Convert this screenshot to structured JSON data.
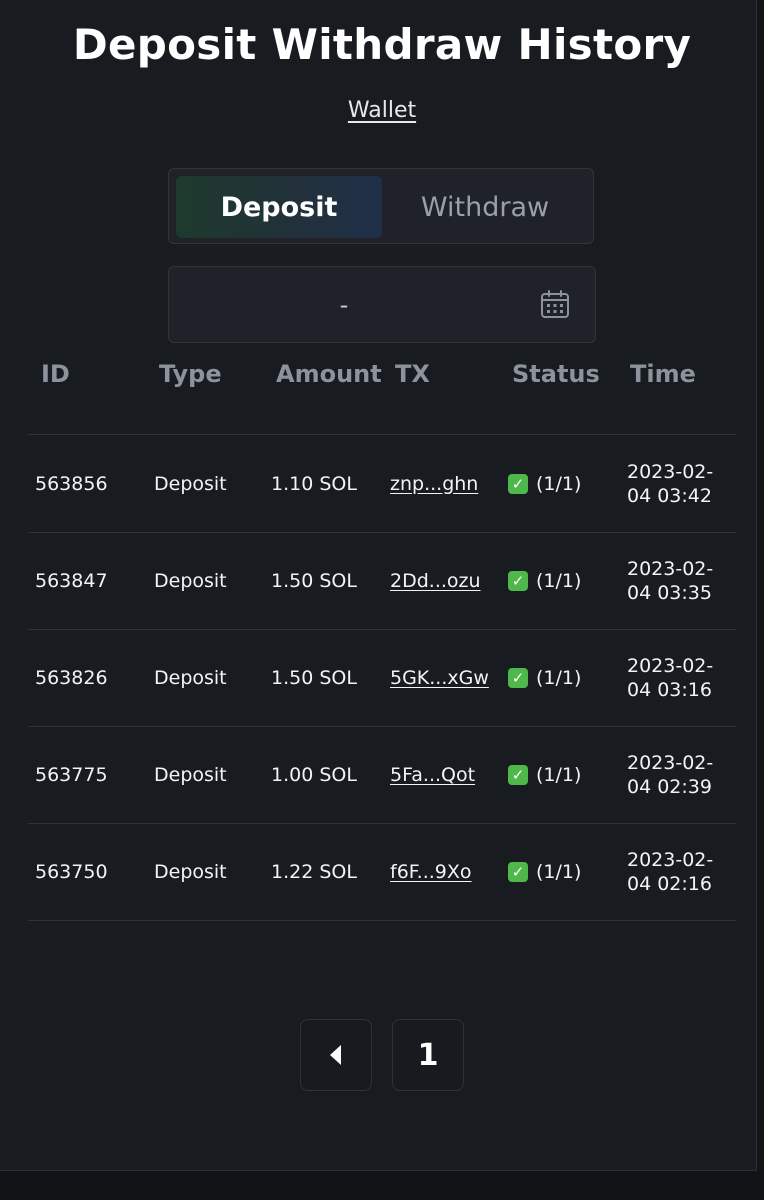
{
  "header": {
    "title": "Deposit Withdraw History",
    "wallet_link": "Wallet"
  },
  "tabs": [
    {
      "label": "Deposit",
      "active": true
    },
    {
      "label": "Withdraw",
      "active": false
    }
  ],
  "date_filter": {
    "value": "-",
    "icon": "calendar-icon"
  },
  "table": {
    "columns": [
      "ID",
      "Type",
      "Amount",
      "TX",
      "Status",
      "Time"
    ],
    "rows": [
      {
        "id": "563856",
        "type": "Deposit",
        "amount": "1.10 SOL",
        "tx": "znp...ghn",
        "status": "(1/1)",
        "time_date": "2023-02-",
        "time_rest": "04 03:42"
      },
      {
        "id": "563847",
        "type": "Deposit",
        "amount": "1.50 SOL",
        "tx": "2Dd...ozu",
        "status": "(1/1)",
        "time_date": "2023-02-",
        "time_rest": "04 03:35"
      },
      {
        "id": "563826",
        "type": "Deposit",
        "amount": "1.50 SOL",
        "tx": "5GK...xGw",
        "status": "(1/1)",
        "time_date": "2023-02-",
        "time_rest": "04 03:16"
      },
      {
        "id": "563775",
        "type": "Deposit",
        "amount": "1.00 SOL",
        "tx": "5Fa...Qot",
        "status": "(1/1)",
        "time_date": "2023-02-",
        "time_rest": "04 02:39"
      },
      {
        "id": "563750",
        "type": "Deposit",
        "amount": "1.22 SOL",
        "tx": "f6F...9Xo",
        "status": "(1/1)",
        "time_date": "2023-02-",
        "time_rest": "04 02:16"
      }
    ]
  },
  "pagination": {
    "prev_icon": "caret-left-icon",
    "current_page": "1"
  },
  "colors": {
    "background": "#181b20",
    "status_success": "#4fb84a",
    "muted_text": "#8c939c"
  }
}
